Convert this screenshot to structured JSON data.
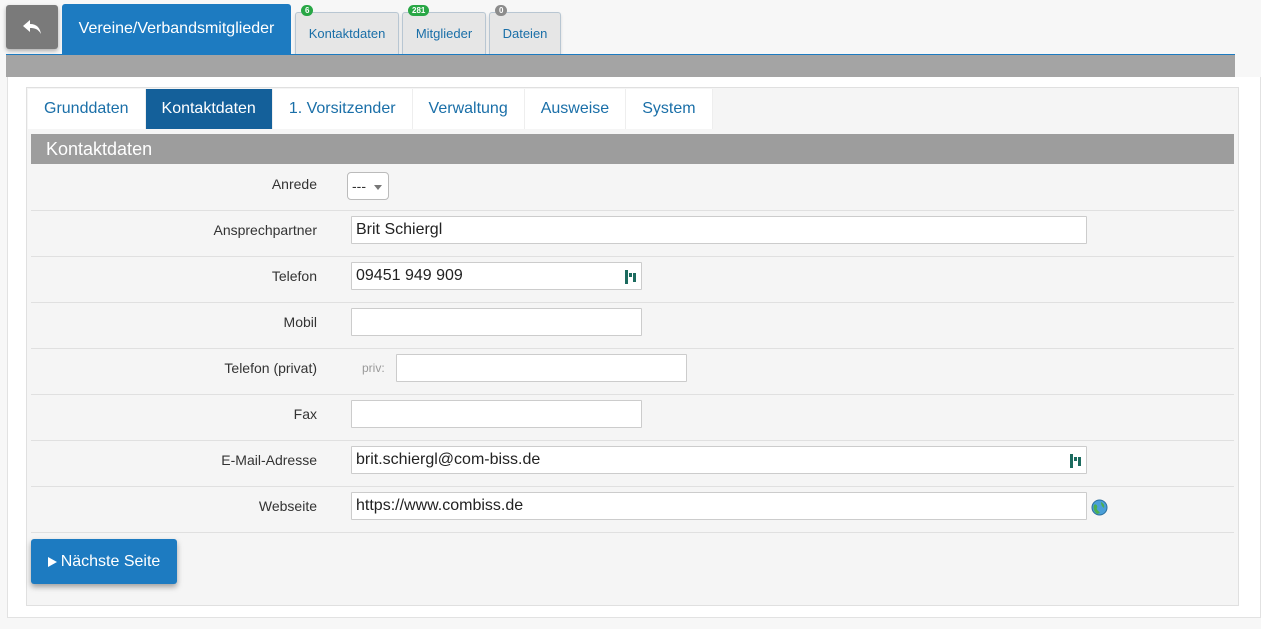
{
  "header": {
    "main_tab": "Vereine/Verbandsmitglieder",
    "tabs": [
      {
        "label": "Kontaktdaten",
        "badge": "6",
        "badge_color": "#28a745"
      },
      {
        "label": "Mitglieder",
        "badge": "281",
        "badge_color": "#28a745"
      },
      {
        "label": "Dateien",
        "badge": "0",
        "badge_color": "#8c8c8c"
      }
    ]
  },
  "subtabs": [
    "Grunddaten",
    "Kontaktdaten",
    "1. Vorsitzender",
    "Verwaltung",
    "Ausweise",
    "System"
  ],
  "active_subtab": "Kontaktdaten",
  "section_title": "Kontaktdaten",
  "form": {
    "anrede": {
      "label": "Anrede",
      "value": "---"
    },
    "ansprechpartner": {
      "label": "Ansprechpartner",
      "value": "Brit Schiergl"
    },
    "telefon": {
      "label": "Telefon",
      "value": "09451 949 909"
    },
    "mobil": {
      "label": "Mobil",
      "value": ""
    },
    "telefon_privat": {
      "label": "Telefon (privat)",
      "prefix": "priv:",
      "value": ""
    },
    "fax": {
      "label": "Fax",
      "value": ""
    },
    "email": {
      "label": "E-Mail-Adresse",
      "value": "brit.schiergl@com-biss.de"
    },
    "webseite": {
      "label": "Webseite",
      "value": "https://www.combiss.de"
    }
  },
  "next_button": {
    "label": "Nächste Seite",
    "icon": "play-icon"
  },
  "colors": {
    "accent": "#1d7bc1",
    "active_subtab": "#14609a",
    "section_header": "#9d9d9d"
  }
}
